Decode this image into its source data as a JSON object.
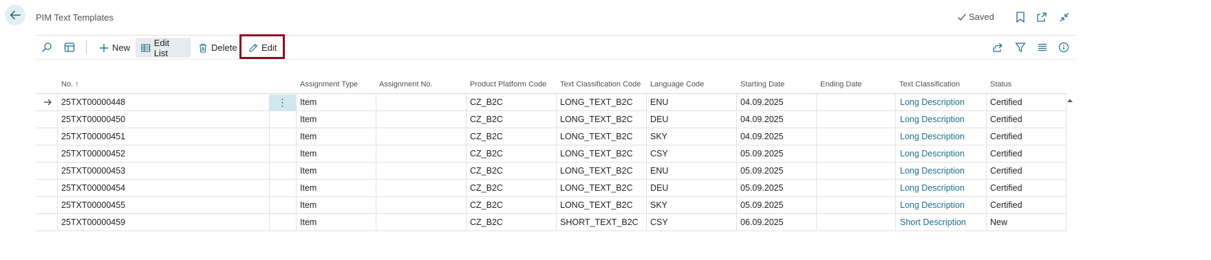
{
  "page": {
    "title": "PIM Text Templates",
    "saved_label": "Saved"
  },
  "toolbar": {
    "new_label": "New",
    "edit_list_label": "Edit List",
    "delete_label": "Delete",
    "edit_label": "Edit"
  },
  "columns": {
    "no": "No. ↑",
    "assignment_type": "Assignment Type",
    "assignment_no": "Assignment No.",
    "product_platform_code": "Product Platform Code",
    "text_classification_code": "Text Classification Code",
    "language_code": "Language Code",
    "starting_date": "Starting Date",
    "ending_date": "Ending Date",
    "text_classification": "Text Classification",
    "status": "Status"
  },
  "rows": [
    {
      "no": "25TXT00000448",
      "assignment_type": "Item",
      "assignment_no": "",
      "platform": "CZ_B2C",
      "class_code": "LONG_TEXT_B2C",
      "lang": "ENU",
      "start": "04.09.2025",
      "end": "",
      "classification": "Long Description",
      "status": "Certified"
    },
    {
      "no": "25TXT00000450",
      "assignment_type": "Item",
      "assignment_no": "",
      "platform": "CZ_B2C",
      "class_code": "LONG_TEXT_B2C",
      "lang": "DEU",
      "start": "04.09.2025",
      "end": "",
      "classification": "Long Description",
      "status": "Certified"
    },
    {
      "no": "25TXT00000451",
      "assignment_type": "Item",
      "assignment_no": "",
      "platform": "CZ_B2C",
      "class_code": "LONG_TEXT_B2C",
      "lang": "SKY",
      "start": "04.09.2025",
      "end": "",
      "classification": "Long Description",
      "status": "Certified"
    },
    {
      "no": "25TXT00000452",
      "assignment_type": "Item",
      "assignment_no": "",
      "platform": "CZ_B2C",
      "class_code": "LONG_TEXT_B2C",
      "lang": "CSY",
      "start": "05.09.2025",
      "end": "",
      "classification": "Long Description",
      "status": "Certified"
    },
    {
      "no": "25TXT00000453",
      "assignment_type": "Item",
      "assignment_no": "",
      "platform": "CZ_B2C",
      "class_code": "LONG_TEXT_B2C",
      "lang": "ENU",
      "start": "05.09.2025",
      "end": "",
      "classification": "Long Description",
      "status": "Certified"
    },
    {
      "no": "25TXT00000454",
      "assignment_type": "Item",
      "assignment_no": "",
      "platform": "CZ_B2C",
      "class_code": "LONG_TEXT_B2C",
      "lang": "DEU",
      "start": "05.09.2025",
      "end": "",
      "classification": "Long Description",
      "status": "Certified"
    },
    {
      "no": "25TXT00000455",
      "assignment_type": "Item",
      "assignment_no": "",
      "platform": "CZ_B2C",
      "class_code": "LONG_TEXT_B2C",
      "lang": "SKY",
      "start": "05.09.2025",
      "end": "",
      "classification": "Long Description",
      "status": "Certified"
    },
    {
      "no": "25TXT00000459",
      "assignment_type": "Item",
      "assignment_no": "",
      "platform": "CZ_B2C",
      "class_code": "SHORT_TEXT_B2C",
      "lang": "CSY",
      "start": "06.09.2025",
      "end": "",
      "classification": "Short Description",
      "status": "New"
    }
  ],
  "icons": {
    "back": "arrow-left-icon",
    "saved": "checkmark-icon",
    "bookmark": "bookmark-icon",
    "open_new": "open-new-window-icon",
    "collapse": "collapse-icon",
    "search": "search-icon",
    "layout": "layout-icon",
    "share": "share-icon",
    "filter": "filter-icon",
    "list_view": "list-view-icon",
    "info": "info-icon"
  },
  "colors": {
    "accent_link": "#1c6f8c",
    "highlight_border": "#8b0a1e",
    "back_button_bg": "#e1eef2"
  }
}
